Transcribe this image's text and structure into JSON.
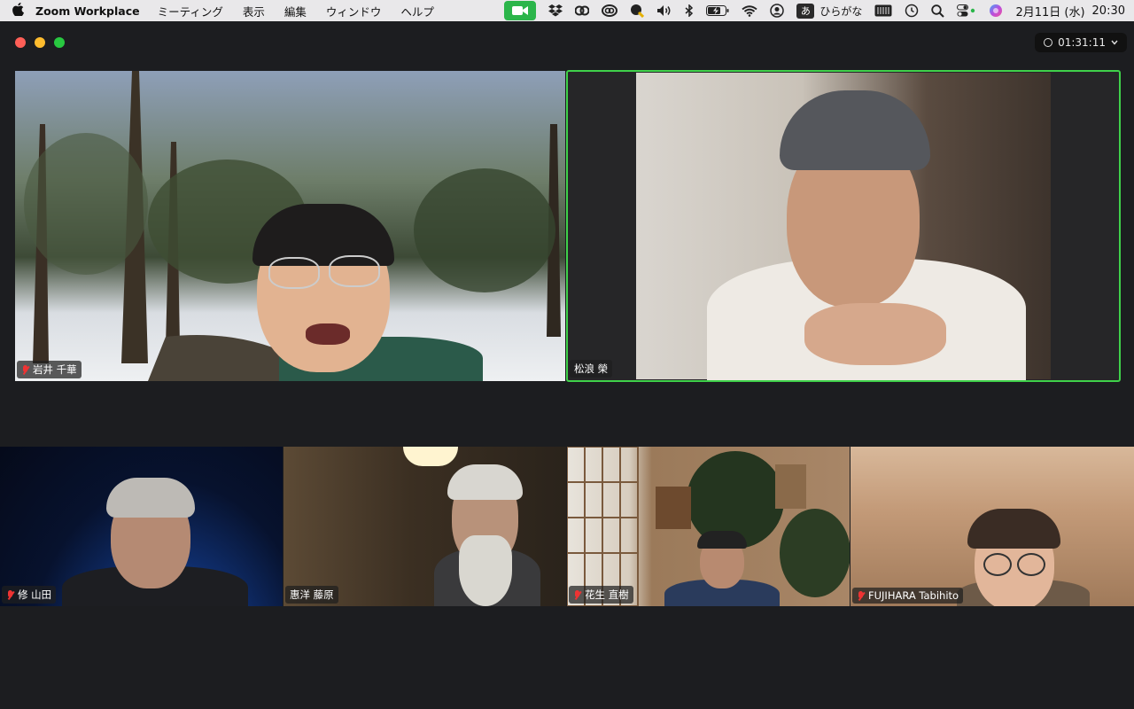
{
  "menubar": {
    "app_name": "Zoom Workplace",
    "menus": [
      "ミーティング",
      "表示",
      "編集",
      "ウィンドウ",
      "ヘルプ"
    ],
    "ime_char": "あ",
    "ime_label": "ひらがな",
    "date": "2月11日 (水)",
    "time": "20:30"
  },
  "meeting": {
    "elapsed": "01:31:11"
  },
  "participants": [
    {
      "name": "岩井 千華",
      "muted": true
    },
    {
      "name": "松浪 榮",
      "muted": false,
      "active_speaker": true
    },
    {
      "name": "修 山田",
      "muted": true
    },
    {
      "name": "惠洋 藤原",
      "muted": false
    },
    {
      "name": "花生 直樹",
      "muted": true
    },
    {
      "name": "FUJIHARA Tabihito",
      "muted": true
    }
  ],
  "colors": {
    "active_speaker_border": "#3fd14a",
    "mute_red": "#e33333",
    "window_bg": "#1c1d20"
  }
}
